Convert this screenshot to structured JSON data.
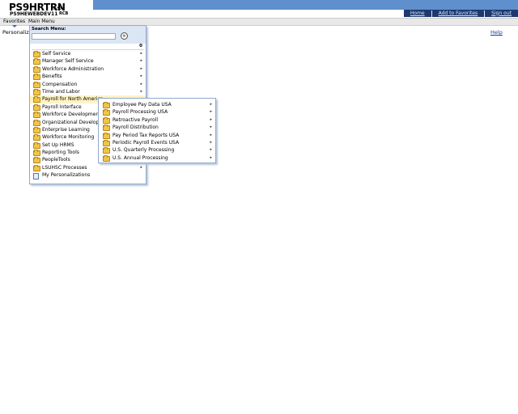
{
  "header": {
    "app_title": "PS9HRTRN",
    "app_version": "8.50",
    "db_name": "PS9HEWEBDEV11",
    "user_code": "RCB",
    "nav_links": [
      "Home",
      "Add to Favorites",
      "Sign out"
    ],
    "colors": {
      "header_bar": "#5f8fcd",
      "nav_bar": "#1d3a6e"
    }
  },
  "menubar": {
    "favorites_label": "Favorites",
    "main_menu_label": "Main Menu"
  },
  "page": {
    "personalize_text": "Personalize",
    "help_link": "Help"
  },
  "main_menu": {
    "search_label": "Search Menu:",
    "search_value": "",
    "search_go_icon": "go-arrow-icon",
    "count_badge": "0",
    "items": [
      {
        "label": "Self Service",
        "icon": "folder-icon",
        "has_submenu": true
      },
      {
        "label": "Manager Self Service",
        "icon": "folder-icon",
        "has_submenu": true
      },
      {
        "label": "Workforce Administration",
        "icon": "folder-icon",
        "has_submenu": true
      },
      {
        "label": "Benefits",
        "icon": "folder-icon",
        "has_submenu": true
      },
      {
        "label": "Compensation",
        "icon": "folder-icon",
        "has_submenu": true
      },
      {
        "label": "Time and Labor",
        "icon": "folder-icon",
        "has_submenu": true
      },
      {
        "label": "Payroll for North America",
        "icon": "folder-icon",
        "has_submenu": true,
        "selected": true
      },
      {
        "label": "Payroll Interface",
        "icon": "folder-icon",
        "has_submenu": true
      },
      {
        "label": "Workforce Development",
        "icon": "folder-icon",
        "has_submenu": true
      },
      {
        "label": "Organizational Developme",
        "icon": "folder-icon",
        "has_submenu": true
      },
      {
        "label": "Enterprise Learning",
        "icon": "folder-icon",
        "has_submenu": true
      },
      {
        "label": "Workforce Monitoring",
        "icon": "folder-icon",
        "has_submenu": true
      },
      {
        "label": "Set Up HRMS",
        "icon": "folder-icon",
        "has_submenu": true
      },
      {
        "label": "Reporting Tools",
        "icon": "folder-icon",
        "has_submenu": true
      },
      {
        "label": "PeopleTools",
        "icon": "folder-icon",
        "has_submenu": true
      },
      {
        "label": "LSUHSC Processes",
        "icon": "folder-icon",
        "has_submenu": true
      },
      {
        "label": "My Personalizations",
        "icon": "page-icon",
        "has_submenu": false
      }
    ]
  },
  "submenu": {
    "items": [
      {
        "label": "Employee Pay Data USA",
        "icon": "folder-icon",
        "has_submenu": true
      },
      {
        "label": "Payroll Processing USA",
        "icon": "folder-icon",
        "has_submenu": true
      },
      {
        "label": "Retroactive Payroll",
        "icon": "folder-icon",
        "has_submenu": true
      },
      {
        "label": "Payroll Distribution",
        "icon": "folder-icon",
        "has_submenu": true
      },
      {
        "label": "Pay Period Tax Reports USA",
        "icon": "folder-icon",
        "has_submenu": true
      },
      {
        "label": "Periodic Payroll Events USA",
        "icon": "folder-icon",
        "has_submenu": true
      },
      {
        "label": "U.S. Quarterly Processing",
        "icon": "folder-icon",
        "has_submenu": true
      },
      {
        "label": "U.S. Annual Processing",
        "icon": "folder-icon",
        "has_submenu": true
      }
    ]
  }
}
